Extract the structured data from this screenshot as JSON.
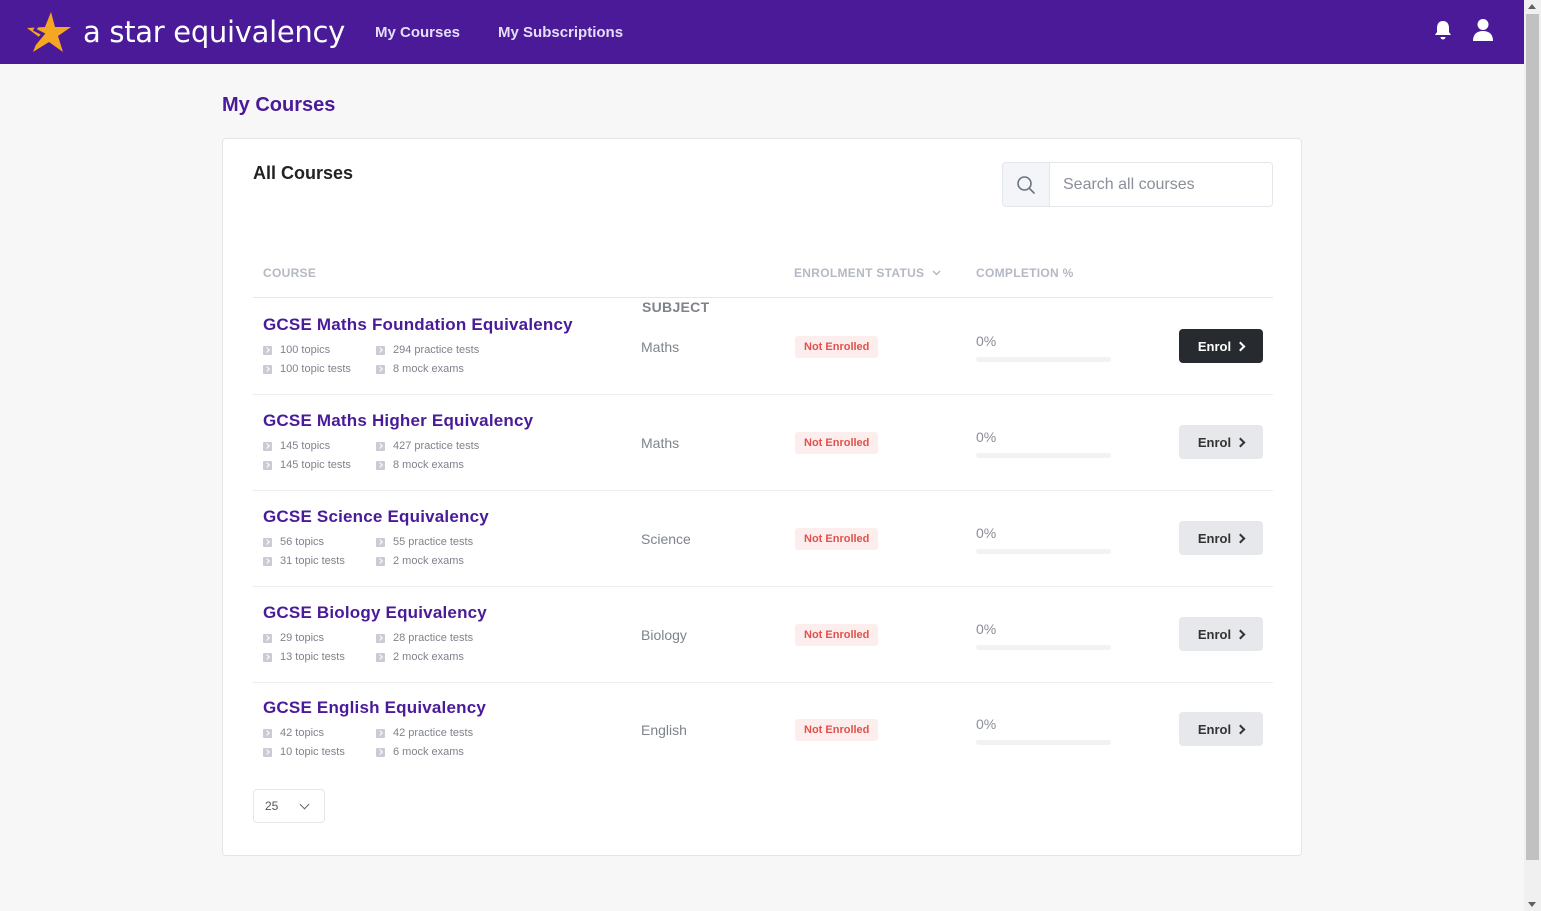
{
  "header": {
    "logo_text": "a star equivalency",
    "nav": [
      "My Courses",
      "My Subscriptions"
    ]
  },
  "page_title": "My Courses",
  "card": {
    "title": "All Courses",
    "search_placeholder": "Search all courses"
  },
  "table": {
    "headers": {
      "course": "COURSE",
      "subject": "SUBJECT",
      "status": "ENROLMENT STATUS",
      "completion": "COMPLETION %"
    },
    "rows": [
      {
        "name": "GCSE Maths Foundation Equivalency",
        "topics": "100 topics",
        "practice": "294 practice tests",
        "topic_tests": "100 topic tests",
        "mock": "8 mock exams",
        "subject": "Maths",
        "status": "Not Enrolled",
        "completion": "0%",
        "completion_fraction": 0,
        "action": "Enrol"
      },
      {
        "name": "GCSE Maths Higher Equivalency",
        "topics": "145 topics",
        "practice": "427 practice tests",
        "topic_tests": "145 topic tests",
        "mock": "8 mock exams",
        "subject": "Maths",
        "status": "Not Enrolled",
        "completion": "0%",
        "completion_fraction": 0,
        "action": "Enrol"
      },
      {
        "name": "GCSE Science Equivalency",
        "topics": "56 topics",
        "practice": "55 practice tests",
        "topic_tests": "31 topic tests",
        "mock": "2 mock exams",
        "subject": "Science",
        "status": "Not Enrolled",
        "completion": "0%",
        "completion_fraction": 0,
        "action": "Enrol"
      },
      {
        "name": "GCSE Biology Equivalency",
        "topics": "29 topics",
        "practice": "28 practice tests",
        "topic_tests": "13 topic tests",
        "mock": "2 mock exams",
        "subject": "Biology",
        "status": "Not Enrolled",
        "completion": "0%",
        "completion_fraction": 0,
        "action": "Enrol"
      },
      {
        "name": "GCSE English Equivalency",
        "topics": "42 topics",
        "practice": "42 practice tests",
        "topic_tests": "10 topic tests",
        "mock": "6 mock exams",
        "subject": "English",
        "status": "Not Enrolled",
        "completion": "0%",
        "completion_fraction": 0,
        "action": "Enrol"
      }
    ]
  },
  "pagination": {
    "page_size": "25"
  },
  "icons": {
    "logo": "star-logo-icon",
    "bell": "bell-icon",
    "user": "user-icon",
    "search": "search-icon",
    "sort": "chevron-down-icon",
    "enrol": "chevron-right-icon"
  },
  "colors": {
    "brand": "#4a1a99",
    "logo_star": "#f5a623",
    "badge_text": "#e2504c",
    "badge_bg": "#fdeeee",
    "primary_button": "#272a2e",
    "secondary_button": "#e6e8eb"
  }
}
